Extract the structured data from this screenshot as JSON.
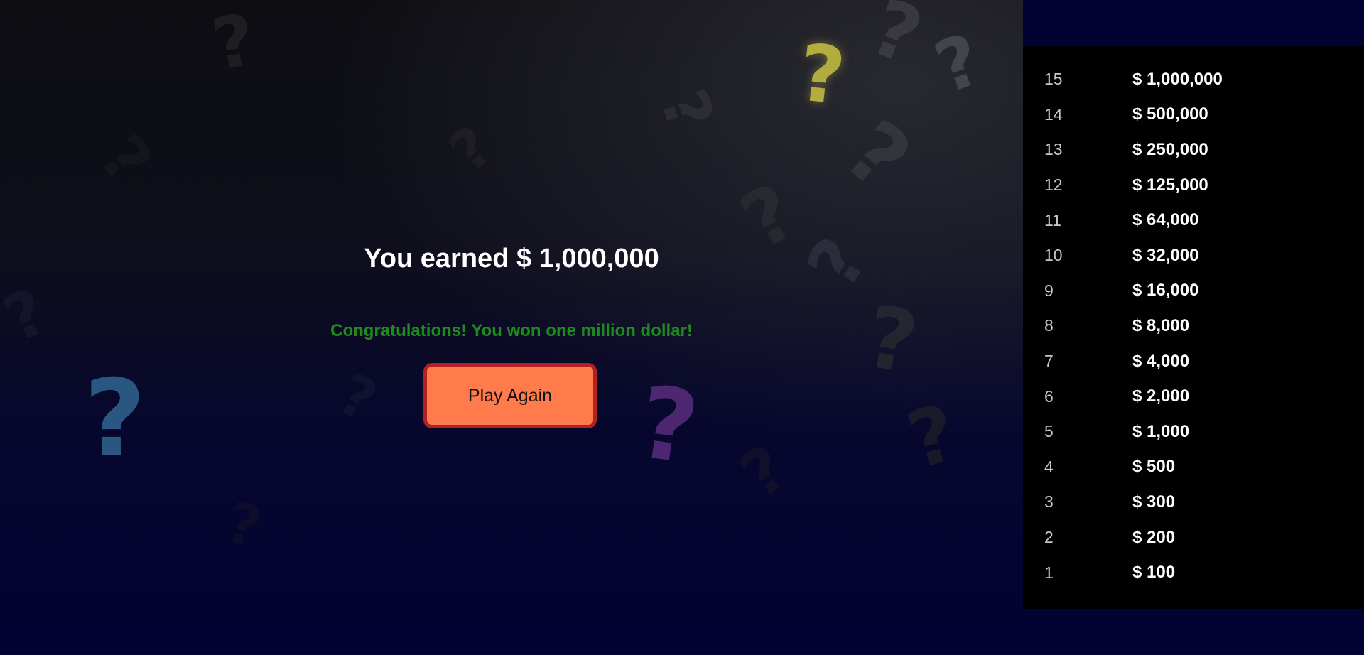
{
  "result": {
    "earned_text": "You earned $ 1,000,000",
    "congrats_text": "Congratulations! You won one million dollar!",
    "play_again_label": "Play Again"
  },
  "money_ladder": [
    {
      "number": "15",
      "amount": "$ 1,000,000"
    },
    {
      "number": "14",
      "amount": "$ 500,000"
    },
    {
      "number": "13",
      "amount": "$ 250,000"
    },
    {
      "number": "12",
      "amount": "$ 125,000"
    },
    {
      "number": "11",
      "amount": "$ 64,000"
    },
    {
      "number": "10",
      "amount": "$ 32,000"
    },
    {
      "number": "9",
      "amount": "$ 16,000"
    },
    {
      "number": "8",
      "amount": "$ 8,000"
    },
    {
      "number": "7",
      "amount": "$ 4,000"
    },
    {
      "number": "6",
      "amount": "$ 2,000"
    },
    {
      "number": "5",
      "amount": "$ 1,000"
    },
    {
      "number": "4",
      "amount": "$ 500"
    },
    {
      "number": "3",
      "amount": "$ 300"
    },
    {
      "number": "2",
      "amount": "$ 200"
    },
    {
      "number": "1",
      "amount": "$ 100"
    }
  ],
  "colors": {
    "background_dark": "#020233",
    "button_fill": "#ff7b4b",
    "button_border": "#b22222",
    "congrats_green": "#1e8b1e",
    "accent_yellow": "#e8e030",
    "accent_blue": "#3a7ab0",
    "accent_purple": "#7a3a9a"
  },
  "background_icon": "question-mark-pattern"
}
